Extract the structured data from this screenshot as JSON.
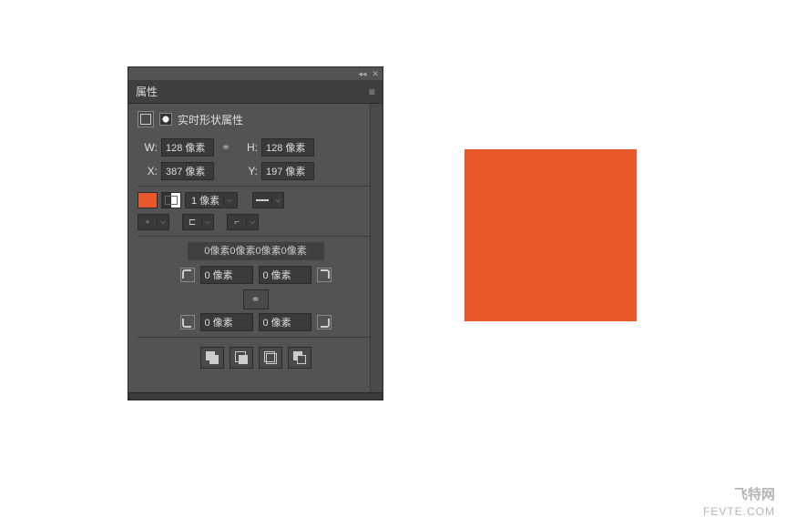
{
  "panel": {
    "title": "属性",
    "subtitle": "实时形状属性",
    "dimensions": {
      "w_label": "W:",
      "w_value": "128 像素",
      "h_label": "H:",
      "h_value": "128 像素",
      "x_label": "X:",
      "x_value": "387 像素",
      "y_label": "Y:",
      "y_value": "197 像素"
    },
    "fill_color": "#e8582a",
    "stroke_width": "1 像素",
    "corners_summary": "0像素0像素0像素0像素",
    "corner_tl": "0 像素",
    "corner_tr": "0 像素",
    "corner_bl": "0 像素",
    "corner_br": "0 像素"
  },
  "canvas": {
    "shape_color": "#e8582a"
  },
  "watermark": {
    "cn": "飞特网",
    "en": "FEVTE.COM"
  }
}
